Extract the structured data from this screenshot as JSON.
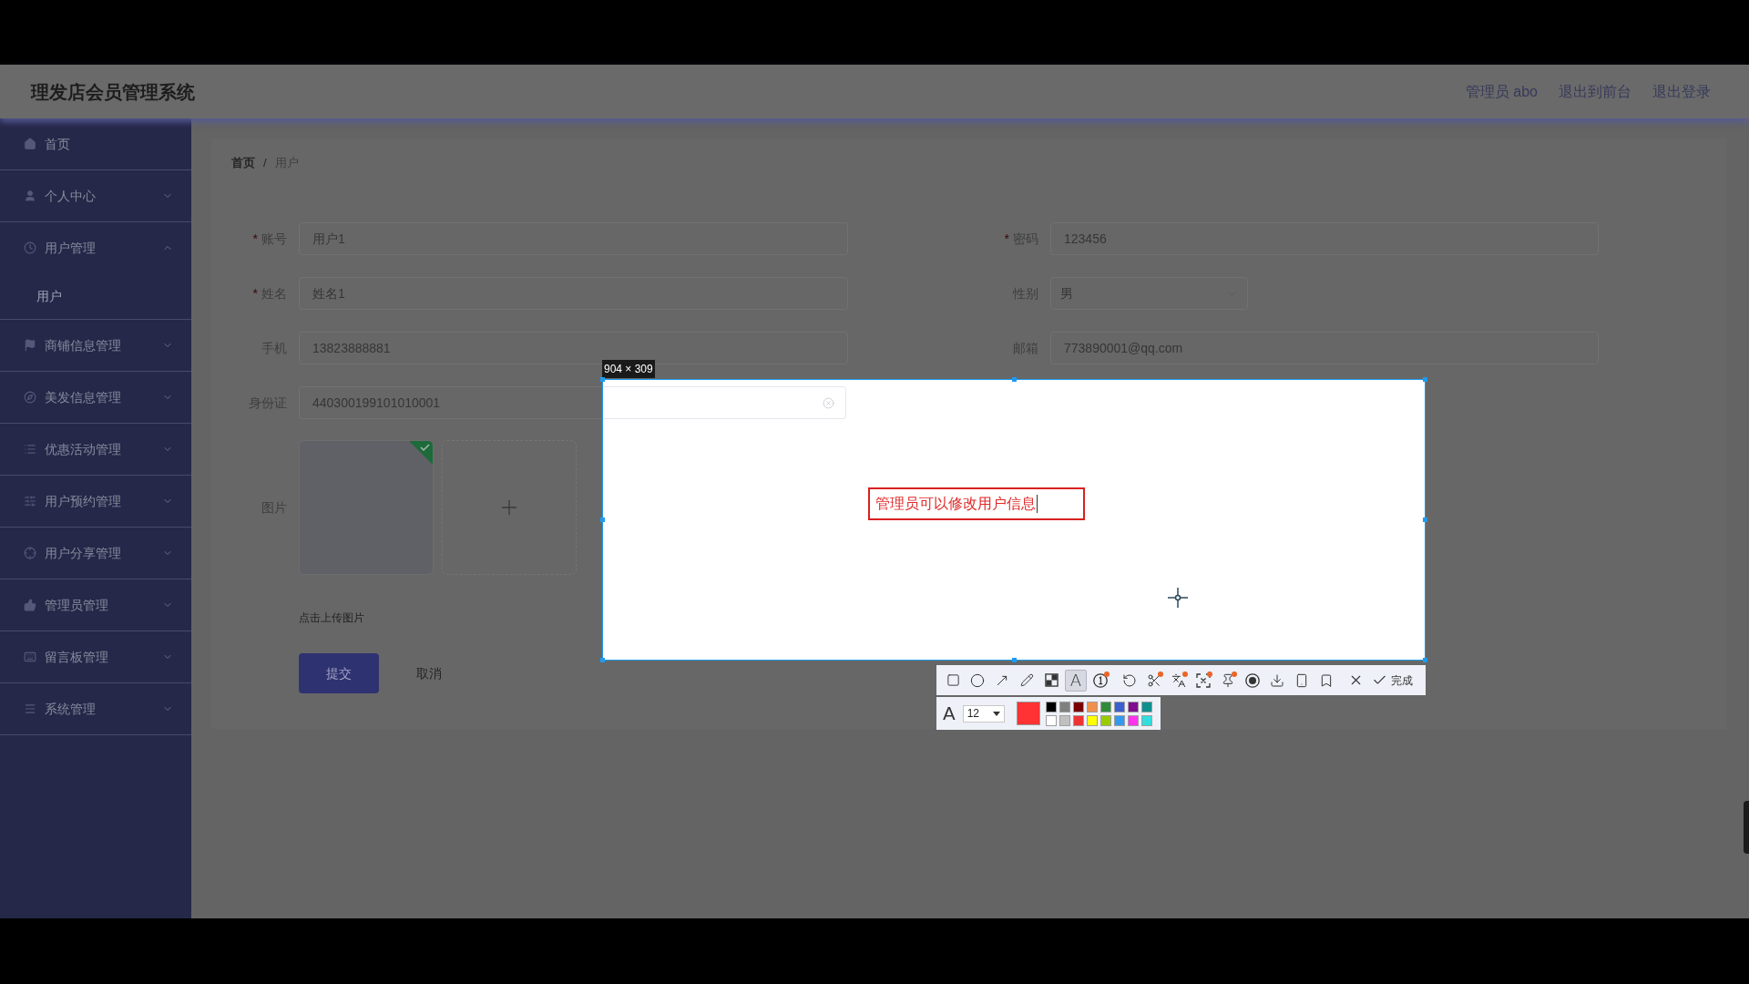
{
  "header": {
    "title": "理发店会员管理系统",
    "links": [
      "管理员 abo",
      "退出到前台",
      "退出登录"
    ]
  },
  "sidebar": {
    "items": [
      {
        "label": "首页",
        "kind": "link"
      },
      {
        "label": "个人中心",
        "kind": "group",
        "expanded": false
      },
      {
        "label": "用户管理",
        "kind": "group",
        "expanded": true,
        "children": [
          {
            "label": "用户",
            "selected": true
          }
        ]
      },
      {
        "label": "商铺信息管理",
        "kind": "group",
        "expanded": false
      },
      {
        "label": "美发信息管理",
        "kind": "group",
        "expanded": false
      },
      {
        "label": "优惠活动管理",
        "kind": "group",
        "expanded": false
      },
      {
        "label": "用户预约管理",
        "kind": "group",
        "expanded": false
      },
      {
        "label": "用户分享管理",
        "kind": "group",
        "expanded": false
      },
      {
        "label": "管理员管理",
        "kind": "group",
        "expanded": false
      },
      {
        "label": "留言板管理",
        "kind": "group",
        "expanded": false
      },
      {
        "label": "系统管理",
        "kind": "group",
        "expanded": false
      }
    ]
  },
  "breadcrumb": {
    "items": [
      "首页",
      "用户"
    ],
    "separator": "/"
  },
  "form": {
    "fields": [
      {
        "label": "账号",
        "required_mark": "*",
        "kind": "input",
        "value": "用户1"
      },
      {
        "label": "密码",
        "required_mark": "*",
        "kind": "input",
        "value": "123456"
      },
      {
        "label": "姓名",
        "required_mark": "*",
        "kind": "input",
        "value": "姓名1"
      },
      {
        "label": "性别",
        "kind": "select",
        "value": "男"
      },
      {
        "label": "手机",
        "kind": "input",
        "value": "13823888881"
      },
      {
        "label": "邮箱",
        "kind": "input",
        "value": "773890001@qq.com"
      },
      {
        "label": "身份证",
        "kind": "input",
        "value": "440300199101010001"
      }
    ],
    "image": {
      "label": "图片",
      "uploaded": true,
      "hint": "点击上传图片"
    },
    "buttons": [
      {
        "label": "提交",
        "kind": "primary"
      },
      {
        "label": "取消",
        "kind": "plain"
      }
    ]
  },
  "screenshot_tool": {
    "size_label": "904 × 309",
    "annotation": {
      "text": "管理员可以修改用户信息"
    },
    "toolbar": {
      "groups": [
        {
          "tools": [
            {
              "kind": "rectangle",
              "selected": false,
              "badge": false
            },
            {
              "kind": "ellipse",
              "selected": false,
              "badge": false
            },
            {
              "kind": "arrow",
              "selected": false,
              "badge": false
            },
            {
              "kind": "pen",
              "selected": false,
              "badge": false
            },
            {
              "kind": "mosaic",
              "selected": false,
              "badge": false
            },
            {
              "kind": "text",
              "glyph": "A",
              "selected": true,
              "badge": false
            },
            {
              "kind": "number",
              "selected": false,
              "badge": true
            }
          ]
        },
        {
          "tools": [
            {
              "kind": "undo",
              "selected": false,
              "badge": false
            },
            {
              "kind": "cut",
              "selected": false,
              "badge": true
            },
            {
              "kind": "translate",
              "selected": false,
              "badge": true
            },
            {
              "kind": "ocr",
              "selected": false,
              "badge": true
            },
            {
              "kind": "pin",
              "selected": false,
              "badge": true
            },
            {
              "kind": "record",
              "selected": false,
              "badge": false
            },
            {
              "kind": "save",
              "selected": false,
              "badge": false
            },
            {
              "kind": "long",
              "selected": false,
              "badge": false
            },
            {
              "kind": "bookmark",
              "selected": false,
              "badge": false
            }
          ]
        },
        {
          "tools": [
            {
              "kind": "close",
              "selected": false,
              "badge": false
            },
            {
              "kind": "done",
              "label": "完成",
              "selected": false,
              "badge": false
            }
          ]
        }
      ]
    },
    "text_options": {
      "glyph": "A",
      "size": "12",
      "current": {
        "color": "#ff3333"
      },
      "swatches": [
        {
          "color": "#000000"
        },
        {
          "color": "#808080"
        },
        {
          "color": "#7a0000"
        },
        {
          "color": "#f0904a"
        },
        {
          "color": "#2e8b3a"
        },
        {
          "color": "#3a5fd0"
        },
        {
          "color": "#7f0f8f"
        },
        {
          "color": "#0f8f8f"
        },
        {
          "color": "#ffffff"
        },
        {
          "color": "#c0c0c0"
        },
        {
          "color": "#ee3333"
        },
        {
          "color": "#ffff00"
        },
        {
          "color": "#99cc00"
        },
        {
          "color": "#3399ee"
        },
        {
          "color": "#ff33ee"
        },
        {
          "color": "#33dddd"
        }
      ]
    }
  }
}
